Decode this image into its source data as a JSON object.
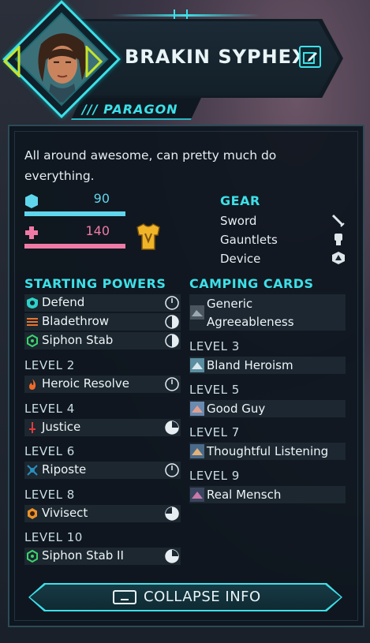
{
  "character": {
    "name": "BRAKIN SYPHEX",
    "class_label": "/// PARAGON",
    "description": "All around awesome, can pretty much do everything."
  },
  "stats": {
    "armor": 90,
    "health": 140
  },
  "gear": {
    "title": "GEAR",
    "items": [
      {
        "label": "Sword",
        "icon": "sword-icon"
      },
      {
        "label": "Gauntlets",
        "icon": "gauntlet-icon"
      },
      {
        "label": "Device",
        "icon": "device-icon"
      }
    ]
  },
  "powers": {
    "title": "STARTING POWERS",
    "starting": [
      {
        "label": "Defend",
        "icon": "shield-icon",
        "color": "#2fd1c9"
      },
      {
        "label": "Bladethrow",
        "icon": "blades-icon",
        "color": "#e9742a"
      },
      {
        "label": "Siphon Stab",
        "icon": "hex-icon",
        "color": "#3bd46b"
      }
    ],
    "levels": [
      {
        "level": "LEVEL 2",
        "label": "Heroic Resolve",
        "icon": "flame-icon",
        "color": "#ef6a2a"
      },
      {
        "level": "LEVEL 4",
        "label": "Justice",
        "icon": "sword-red-icon",
        "color": "#e23b3b"
      },
      {
        "level": "LEVEL 6",
        "label": "Riposte",
        "icon": "riposte-icon",
        "color": "#2a8fbf"
      },
      {
        "level": "LEVEL 8",
        "label": "Vivisect",
        "icon": "vivisect-icon",
        "color": "#e9922a"
      },
      {
        "level": "LEVEL 10",
        "label": "Siphon Stab II",
        "icon": "hex-icon",
        "color": "#3bd46b"
      }
    ]
  },
  "camping": {
    "title": "CAMPING CARDS",
    "starting": {
      "label_line1": "Generic",
      "label_line2": "Agreeableness"
    },
    "levels": [
      {
        "level": "LEVEL 3",
        "label": "Bland Heroism"
      },
      {
        "level": "LEVEL 5",
        "label": "Good Guy"
      },
      {
        "level": "LEVEL 7",
        "label": "Thoughtful Listening"
      },
      {
        "level": "LEVEL 9",
        "label": "Real Mensch"
      }
    ]
  },
  "collapse": {
    "label": "COLLAPSE INFO"
  },
  "colors": {
    "accent": "#3de0e8",
    "armor_bar": "#5fd6ec",
    "health_bar": "#f07aa6",
    "panel_bg": "#0e161e"
  }
}
